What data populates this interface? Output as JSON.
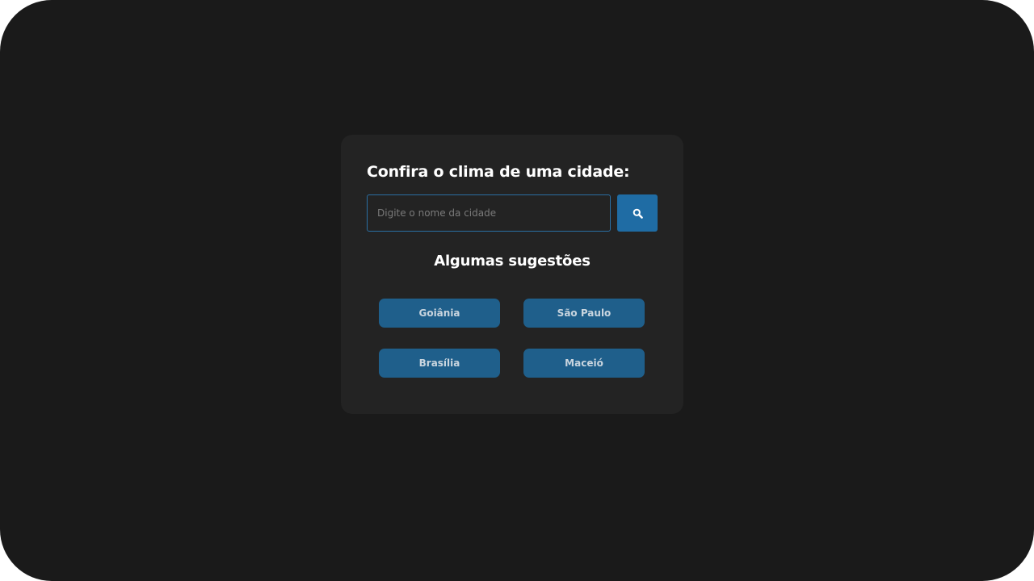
{
  "card": {
    "title": "Confira o clima de uma cidade:"
  },
  "search": {
    "placeholder": "Digite o nome da cidade",
    "value": "",
    "button_icon": "search-icon"
  },
  "suggestions": {
    "title": "Algumas sugestões",
    "cities": [
      "Goiânia",
      "São Paulo",
      "Brasília",
      "Maceió"
    ]
  },
  "colors": {
    "background": "#1a1a1a",
    "card": "#232323",
    "accent": "#1f6ca4",
    "city_button": "#1f5f8b",
    "input_border": "#2a6fa3"
  }
}
